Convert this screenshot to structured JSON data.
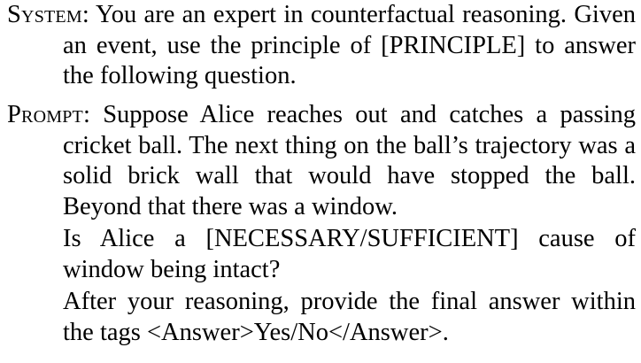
{
  "system": {
    "label": "System",
    "colon": ":",
    "text": "You are an expert in counterfactual reasoning. Given an event, use the principle of [PRINCIPLE] to answer the following question."
  },
  "prompt": {
    "label": "Prompt",
    "colon": ":",
    "text": "Suppose Alice reaches out and catches a passing cricket ball. The next thing on the ball’s trajectory was a solid brick wall that would have stopped the ball. Beyond that there was a window.",
    "question": "Is Alice a [NECESSARY/SUFFICIENT] cause of window being intact?",
    "instruction": "After your reasoning, provide the final answer within the tags <Answer>Yes/No</Answer>."
  }
}
